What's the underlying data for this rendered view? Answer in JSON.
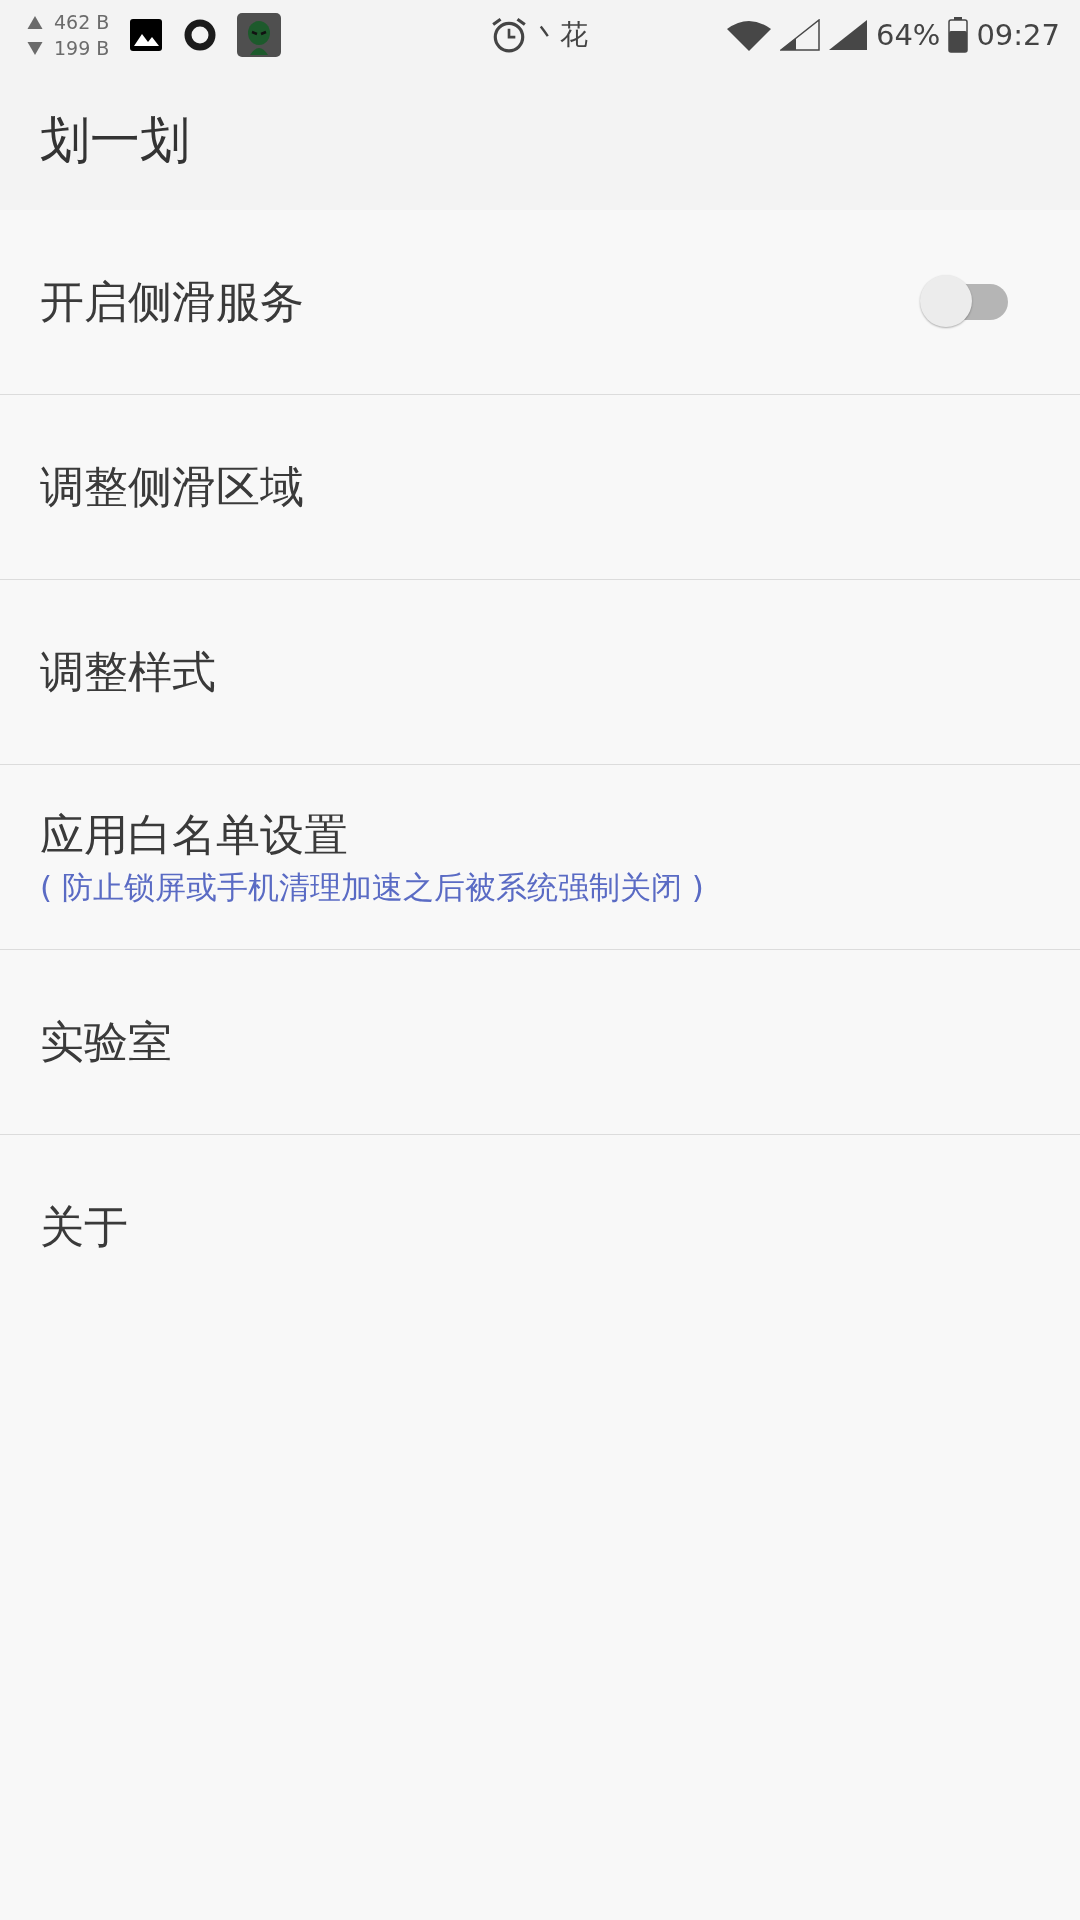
{
  "status_bar": {
    "upload": "462 B",
    "download": "199 B",
    "carrier": "丶花",
    "battery": "64%",
    "time": "09:27"
  },
  "app_bar": {
    "title": "划一划"
  },
  "settings": [
    {
      "kind": "switch",
      "label": "开启侧滑服务",
      "on": false
    },
    {
      "kind": "plain",
      "label": "调整侧滑区域"
    },
    {
      "kind": "plain",
      "label": "调整样式"
    },
    {
      "kind": "plain",
      "label": "应用白名单设置",
      "note": "( 防止锁屏或手机清理加速之后被系统强制关闭 )"
    },
    {
      "kind": "plain",
      "label": "实验室"
    },
    {
      "kind": "plain",
      "label": "关于"
    }
  ]
}
